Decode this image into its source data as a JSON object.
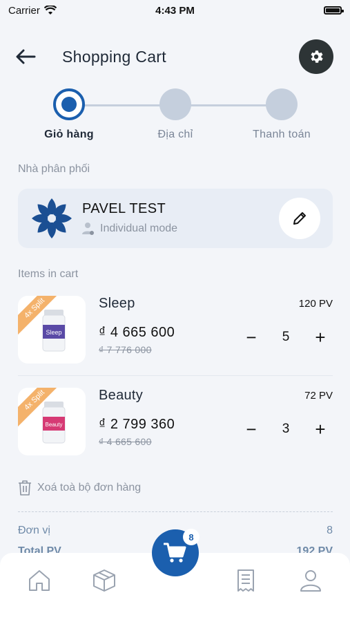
{
  "status_bar": {
    "carrier": "Carrier",
    "time": "4:43 PM"
  },
  "header": {
    "title": "Shopping Cart"
  },
  "stepper": {
    "steps": [
      {
        "label": "Giỏ hàng",
        "active": true
      },
      {
        "label": "Địa chỉ",
        "active": false
      },
      {
        "label": "Thanh toán",
        "active": false
      }
    ]
  },
  "distributor": {
    "section_label": "Nhà phân phối",
    "name": "PAVEL TEST",
    "mode": "Individual mode"
  },
  "cart": {
    "section_label": "Items in cart",
    "items": [
      {
        "ribbon": "4x Split",
        "product_label": "Sleep",
        "name": "Sleep",
        "pv": "120 PV",
        "price": "₫ 4 665 600",
        "old_price": "₫ 7 776 000",
        "quantity": "5",
        "minus": "−",
        "plus": "+"
      },
      {
        "ribbon": "4x Split",
        "product_label": "Beauty",
        "name": "Beauty",
        "pv": "72 PV",
        "price": "₫ 2 799 360",
        "old_price": "₫ 4 665 600",
        "quantity": "3",
        "minus": "−",
        "plus": "+"
      }
    ],
    "clear_label": "Xoá toà bộ đơn hàng"
  },
  "summary": {
    "rows": [
      {
        "label": "Đơn vị",
        "value": "8"
      },
      {
        "label": "Total PV",
        "value": "192 PV"
      }
    ]
  },
  "bottom_nav": {
    "cart_badge": "8"
  },
  "colors": {
    "accent": "#1b5fae",
    "step_inactive": "#c5cfdd",
    "settings_bg": "#2d3436"
  }
}
